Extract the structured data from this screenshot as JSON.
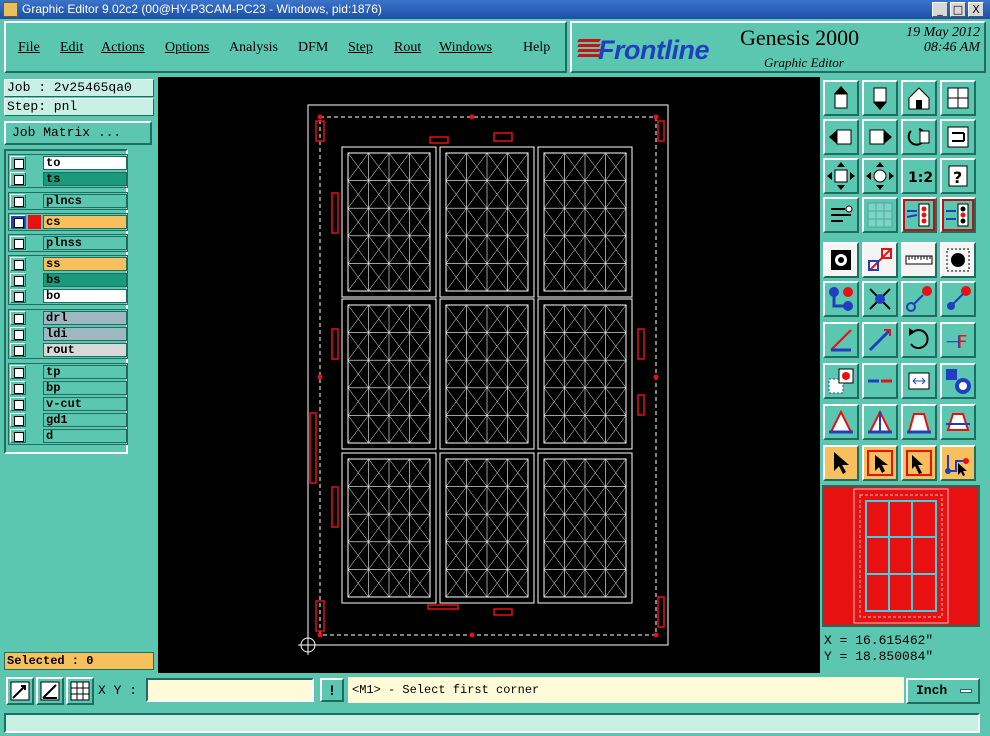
{
  "window": {
    "title": "Graphic Editor 9.02c2 (00@HY-P3CAM-PC23 - Windows, pid:1876)",
    "min_glyph": "_",
    "max_glyph": "□",
    "close_glyph": "X"
  },
  "menu": {
    "items": [
      "File",
      "Edit",
      "Actions",
      "Options",
      "Analysis",
      "DFM",
      "Step",
      "Rout",
      "Windows",
      "Help"
    ]
  },
  "brand": {
    "logo_text": "Frontline",
    "product": "Genesis 2000",
    "subtitle": "Graphic Editor",
    "date": "19 May 2012",
    "time": "08:46 AM"
  },
  "job": {
    "job_line": "Job : 2v25465qa0",
    "step_line": "Step: pnl",
    "job_matrix_label": "Job Matrix ..."
  },
  "layers": [
    {
      "name": "to",
      "color": "#ffffff"
    },
    {
      "name": "ts",
      "color": "#1a9a7a"
    },
    {
      "name": "plncs",
      "color": "#5cc7b0"
    },
    {
      "name": "cs",
      "color": "#f7c05c"
    },
    {
      "name": "plnss",
      "color": "#5cc7b0"
    },
    {
      "name": "ss",
      "color": "#f7c05c"
    },
    {
      "name": "bs",
      "color": "#1a9a7a"
    },
    {
      "name": "bo",
      "color": "#ffffff"
    },
    {
      "name": "drl",
      "color": "#9fb7c0"
    },
    {
      "name": "ldi",
      "color": "#9fb7c0"
    },
    {
      "name": "rout",
      "color": "#d8d8d8"
    },
    {
      "name": "tp",
      "color": "#5cc7b0"
    },
    {
      "name": "bp",
      "color": "#5cc7b0"
    },
    {
      "name": "v-cut",
      "color": "#5cc7b0"
    },
    {
      "name": "gd1",
      "color": "#5cc7b0"
    },
    {
      "name": "d",
      "color": "#5cc7b0"
    }
  ],
  "selected_text": "Selected : 0",
  "cursor": {
    "x_line": "X = 16.615462\"",
    "y_line": "Y = 18.850084\""
  },
  "bottom": {
    "xy_label": "X Y :",
    "xy_value": "",
    "excl_label": "!",
    "prompt": "<M1> - Select first corner",
    "unit": "Inch",
    "status": ""
  },
  "colors": {
    "panel": "#5cc7b0",
    "canvas": "#000000",
    "highlight": "#f7c05c",
    "accent_red": "#e81010"
  }
}
